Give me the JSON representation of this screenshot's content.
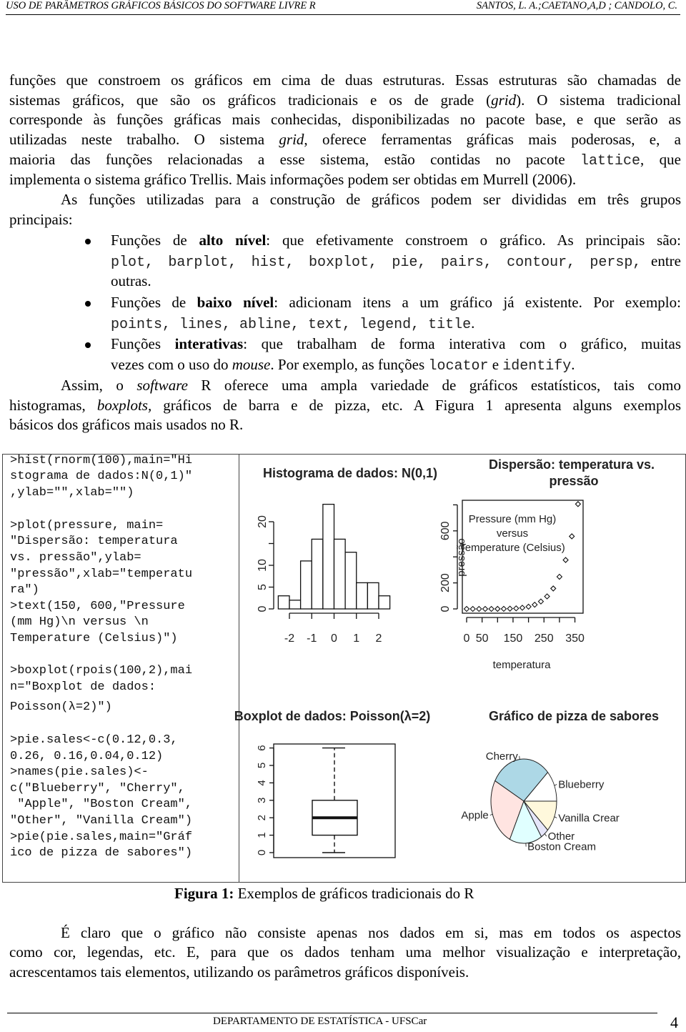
{
  "header": {
    "left": "USO DE PARÂMETROS GRÁFICOS BÁSICOS DO SOFTWARE LIVRE R",
    "right": "SANTOS, L. A.;CAETANO,A,D ; CANDOLO, C."
  },
  "body": {
    "lines": [
      [
        {
          "t": "funções que constroem os gráficos em cima de duas estruturas. Essas estruturas são chamadas de"
        }
      ],
      [
        {
          "t": "sistemas gráficos, que são os gráficos tradicionais e os de grade ("
        },
        {
          "t": "grid",
          "s": "i"
        },
        {
          "t": "). O sistema tradicional"
        }
      ],
      [
        {
          "t": "corresponde às funções gráficas mais conhecidas, disponibilizadas no pacote base, e que serão as"
        }
      ],
      [
        {
          "t": "utilizadas neste trabalho. O sistema "
        },
        {
          "t": "grid",
          "s": "i"
        },
        {
          "t": ", oferece ferramentas gráficas mais poderosas, e, a"
        }
      ],
      [
        {
          "t": "maioria das funções relacionadas a esse sistema, estão contidas no pacote "
        },
        {
          "t": "lattice",
          "s": "c"
        },
        {
          "t": ", que"
        }
      ],
      [
        {
          "t": "implementa o sistema gráfico Trellis. Mais informações podem ser obtidas em Murrell (2006)."
        }
      ],
      [
        {
          "t": "As funções utilizadas para a construção de gráficos podem ser divididas em três grupos"
        }
      ],
      [
        {
          "t": "principais:"
        }
      ],
      [
        {
          "t": "Funções de "
        },
        {
          "t": "alto nível",
          "s": "b"
        },
        {
          "t": ": que efetivamente constroem o gráfico. As principais são:"
        }
      ],
      [
        {
          "t": "plot, barplot, hist, boxplot, pie, pairs, contour, persp,",
          "s": "c"
        },
        {
          "t": " entre"
        }
      ],
      [
        {
          "t": "outras."
        }
      ],
      [
        {
          "t": "Funções de "
        },
        {
          "t": "baixo nível",
          "s": "b"
        },
        {
          "t": ": adicionam itens a um gráfico já existente. Por exemplo:"
        }
      ],
      [
        {
          "t": "points, lines, abline, text, legend, title",
          "s": "c"
        },
        {
          "t": "."
        }
      ],
      [
        {
          "t": "Funções "
        },
        {
          "t": "interativas",
          "s": "b"
        },
        {
          "t": ": que trabalham de forma interativa com o gráfico, muitas"
        }
      ],
      [
        {
          "t": "vezes com o uso do "
        },
        {
          "t": "mouse",
          "s": "i"
        },
        {
          "t": ". Por exemplo, as funções "
        },
        {
          "t": "locator",
          "s": "c"
        },
        {
          "t": " e "
        },
        {
          "t": "identify",
          "s": "c"
        },
        {
          "t": "."
        }
      ],
      [
        {
          "t": "Assim, o "
        },
        {
          "t": "software",
          "s": "i"
        },
        {
          "t": " R oferece uma ampla variedade de gráficos estatísticos, tais como"
        }
      ],
      [
        {
          "t": "histogramas, "
        },
        {
          "t": "boxplots,",
          "s": "i"
        },
        {
          "t": " gráficos de barra e de pizza, etc. A Figura 1 apresenta alguns exemplos"
        }
      ],
      [
        {
          "t": "básicos dos gráficos mais usados no R."
        }
      ]
    ],
    "after": [
      [
        {
          "t": "É claro que o gráfico não consiste apenas nos dados em si, mas em todos os aspectos"
        }
      ],
      [
        {
          "t": "como cor, legendas, etc. E, para que os dados tenham uma melhor visualização e interpretação,"
        }
      ],
      [
        {
          "t": "acrescentamos tais elementos, utilizando os parâmetros gráficos disponíveis."
        }
      ]
    ]
  },
  "code": [
    ">hist(rnorm(100),main=\"Hi",
    "stograma de dados:N(0,1)\"",
    ",ylab=\"\",xlab=\"\")",
    ">plot(pressure, main=",
    "\"Dispersão: temperatura",
    "vs. pressão\",ylab=",
    "\"pressão\",xlab=\"temperatu",
    "ra\")",
    ">text(150, 600,\"Pressure",
    "(mm Hg)\\n versus \\n",
    "Temperature (Celsius)\")",
    ">boxplot(rpois(100,2),mai",
    "n=\"Boxplot de dados:",
    "Poisson(λ=2)\")",
    ">pie.sales<-c(0.12,0.3,",
    "0.26, 0.16,0.04,0.12)",
    ">names(pie.sales)<-",
    "c(\"Blueberry\", \"Cherry\",",
    " \"Apple\", \"Boston Cream\",",
    "\"Other\", \"Vanilla Cream\")",
    ">pie(pie.sales,main=\"Gráf",
    "ico de pizza de sabores\")"
  ],
  "caption": {
    "label": "Figura 1:",
    "text": " Exemplos de gráficos tradicionais do R"
  },
  "footer": {
    "text": "DEPARTAMENTO DE ESTATÍSTICA  -  UFSCar",
    "page": "4"
  },
  "chart_data": [
    {
      "type": "bar",
      "title": "Histograma de dados: N(0,1)",
      "bins": [
        -2.5,
        -2,
        -1.5,
        -1,
        -0.5,
        0,
        0.5,
        1,
        1.5,
        2,
        2.5
      ],
      "counts": [
        3,
        2,
        11,
        16,
        24,
        16,
        13,
        6,
        6,
        3
      ],
      "xticks": [
        -2,
        -1,
        0,
        1,
        2
      ],
      "yticks": [
        0,
        5,
        10,
        15,
        20
      ],
      "ytick_labels": [
        "0",
        "5",
        "10",
        "",
        "20"
      ],
      "xlabel": "",
      "ylabel": ""
    },
    {
      "type": "scatter",
      "title": "Dispersão: temperatura vs. pressão",
      "x": [
        0,
        20,
        40,
        60,
        80,
        100,
        120,
        140,
        160,
        180,
        200,
        220,
        240,
        260,
        280,
        300,
        320,
        340,
        360
      ],
      "y": [
        0.0002,
        0.0012,
        0.006,
        0.03,
        0.09,
        0.27,
        0.75,
        1.85,
        4.2,
        8.8,
        17.3,
        32.1,
        57,
        96,
        157,
        247,
        376,
        558,
        806
      ],
      "xlabel": "temperatura",
      "ylabel": "pressão",
      "xlim": [
        0,
        360
      ],
      "ylim": [
        0,
        806
      ],
      "xticks": [
        0,
        50,
        100,
        150,
        200,
        250,
        300,
        350
      ],
      "xtick_labels": [
        "0",
        "50",
        "",
        "150",
        "",
        "250",
        "",
        "350"
      ],
      "yticks": [
        0,
        200,
        400,
        600,
        800
      ],
      "ytick_labels": [
        "0",
        "200",
        "",
        "600",
        ""
      ],
      "annotation": [
        "Pressure (mm Hg)",
        "versus",
        "Temperature (Celsius)"
      ]
    },
    {
      "type": "boxplot",
      "title": "Boxplot de dados: Poisson(λ=2)",
      "min": 0,
      "q1": 1,
      "median": 2,
      "q3": 3,
      "max": 6,
      "yticks": [
        0,
        1,
        2,
        3,
        4,
        5,
        6
      ]
    },
    {
      "type": "pie",
      "title": "Gráfico de pizza de sabores",
      "labels": [
        "Blueberry",
        "Cherry",
        "Apple",
        "Boston Cream",
        "Other",
        "Vanilla Crear"
      ],
      "values": [
        0.12,
        0.3,
        0.26,
        0.16,
        0.04,
        0.12
      ],
      "colors": [
        "#ffffff",
        "#add8e6",
        "#ffe4e1",
        "#e0ffff",
        "#e6e6fa",
        "#fff8dc"
      ]
    }
  ]
}
